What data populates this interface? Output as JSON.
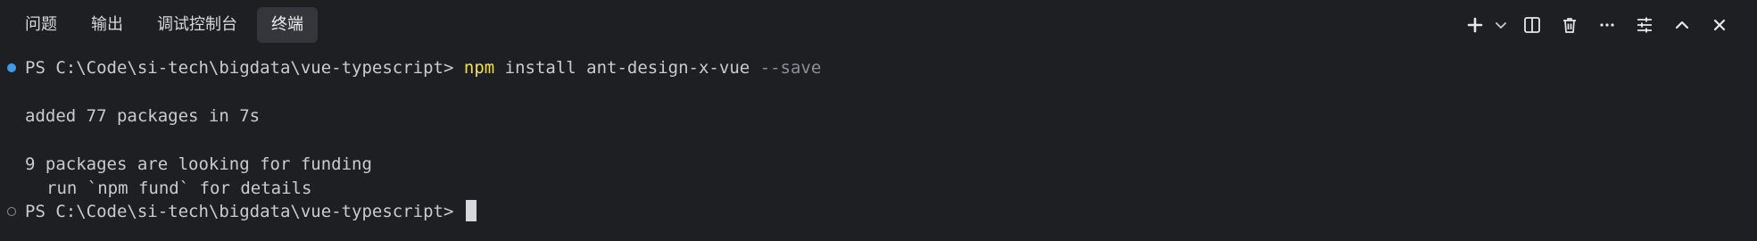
{
  "panel": {
    "tabs": [
      {
        "label": "问题",
        "active": false
      },
      {
        "label": "输出",
        "active": false
      },
      {
        "label": "调试控制台",
        "active": false
      },
      {
        "label": "终端",
        "active": true
      }
    ],
    "actions": [
      {
        "icon": "plus-icon"
      },
      {
        "icon": "chevron-down-icon"
      },
      {
        "icon": "split-terminal-icon"
      },
      {
        "icon": "trash-icon"
      },
      {
        "icon": "more-icon"
      },
      {
        "icon": "settings-sliders-icon"
      },
      {
        "icon": "chevron-up-icon"
      },
      {
        "icon": "close-icon"
      }
    ]
  },
  "terminal": {
    "line1": {
      "prompt": "PS C:\\Code\\si-tech\\bigdata\\vue-typescript> ",
      "command": "npm",
      "args": " install ant-design-x-vue ",
      "flag": "--save"
    },
    "line2": "added 77 packages in 7s",
    "line3": "9 packages are looking for funding",
    "line4": "run `npm fund` for details",
    "line5": {
      "prompt": "PS C:\\Code\\si-tech\\bigdata\\vue-typescript> "
    }
  },
  "colors": {
    "background": "#1e1f22",
    "tab_active_bg": "#34363b",
    "npm_command": "#f1de5a",
    "flag_dim": "#8a8f98",
    "success_marker": "#3d9be9"
  }
}
